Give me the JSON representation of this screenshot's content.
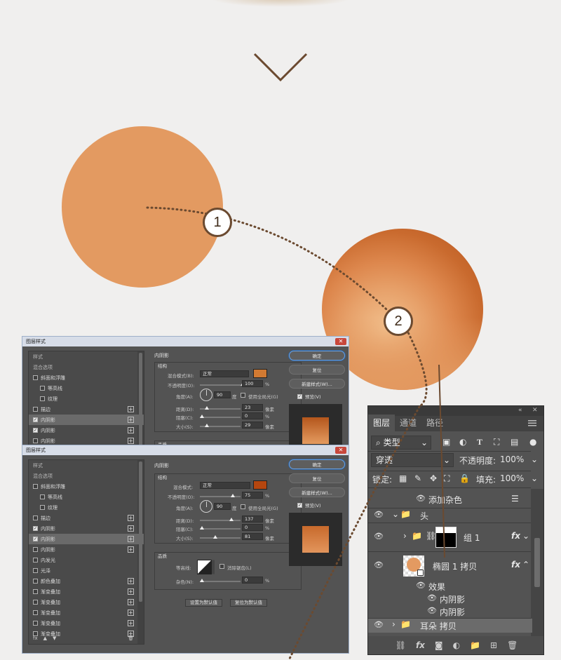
{
  "colors": {
    "background": "#f0efee",
    "accent_orange": "#e39a61",
    "line_brown": "#6b4a30"
  },
  "steps": [
    "1",
    "2"
  ],
  "dialog_top": {
    "title": "图层样式",
    "styles": [
      {
        "label": "样式",
        "checkbox": false,
        "checked": false,
        "plus": false
      },
      {
        "label": "混合选项",
        "checkbox": false,
        "checked": false,
        "plus": false
      },
      {
        "label": "斜面和浮雕",
        "checkbox": true,
        "checked": false,
        "plus": false
      },
      {
        "label": "等高线",
        "checkbox": true,
        "checked": false,
        "plus": false,
        "indent": true
      },
      {
        "label": "纹理",
        "checkbox": true,
        "checked": false,
        "plus": false,
        "indent": true
      },
      {
        "label": "描边",
        "checkbox": true,
        "checked": false,
        "plus": true
      },
      {
        "label": "内阴影",
        "checkbox": true,
        "checked": true,
        "plus": true,
        "selected": true
      },
      {
        "label": "内阴影",
        "checkbox": true,
        "checked": true,
        "plus": true
      },
      {
        "label": "内阴影",
        "checkbox": true,
        "checked": false,
        "plus": true
      }
    ],
    "section_title": "内阴影",
    "group_title": "结构",
    "blend_label": "混合模式(B):",
    "blend_value": "正常",
    "swatch_color": "#d27a32",
    "opacity_label": "不透明度(O):",
    "opacity_value": "100",
    "opacity_fraction": 1.0,
    "angle_label": "角度(A):",
    "angle_value": "90",
    "angle_unit": "度",
    "global_light": "使用全局光(G)",
    "distance_label": "距离(D):",
    "distance_value": "23",
    "distance_fraction": 0.12,
    "choke_label": "阻塞(C):",
    "choke_value": "0",
    "choke_fraction": 0.0,
    "size_label": "大小(S):",
    "size_value": "29",
    "size_fraction": 0.12,
    "unit_px": "像素",
    "unit_pct": "%",
    "quality_title": "品质",
    "buttons": [
      "确定",
      "复位",
      "新建样式(W)..."
    ],
    "preview_label": "预览(V)",
    "preview_color": "#c8743a"
  },
  "dialog_bottom": {
    "title": "图层样式",
    "styles": [
      {
        "label": "样式",
        "checkbox": false,
        "checked": false,
        "plus": false
      },
      {
        "label": "混合选项",
        "checkbox": false,
        "checked": false,
        "plus": false
      },
      {
        "label": "斜面和浮雕",
        "checkbox": true,
        "checked": false,
        "plus": false
      },
      {
        "label": "等高线",
        "checkbox": true,
        "checked": false,
        "plus": false,
        "indent": true
      },
      {
        "label": "纹理",
        "checkbox": true,
        "checked": false,
        "plus": false,
        "indent": true
      },
      {
        "label": "描边",
        "checkbox": true,
        "checked": false,
        "plus": true
      },
      {
        "label": "内阴影",
        "checkbox": true,
        "checked": true,
        "plus": true
      },
      {
        "label": "内阴影",
        "checkbox": true,
        "checked": true,
        "plus": true,
        "selected": true
      },
      {
        "label": "内阴影",
        "checkbox": true,
        "checked": false,
        "plus": true
      },
      {
        "label": "内发光",
        "checkbox": true,
        "checked": false,
        "plus": false
      },
      {
        "label": "光泽",
        "checkbox": true,
        "checked": false,
        "plus": false
      },
      {
        "label": "颜色叠加",
        "checkbox": true,
        "checked": false,
        "plus": true
      },
      {
        "label": "渐变叠加",
        "checkbox": true,
        "checked": false,
        "plus": true
      },
      {
        "label": "渐变叠加",
        "checkbox": true,
        "checked": false,
        "plus": true
      },
      {
        "label": "渐变叠加",
        "checkbox": true,
        "checked": false,
        "plus": true
      },
      {
        "label": "渐变叠加",
        "checkbox": true,
        "checked": false,
        "plus": true
      },
      {
        "label": "渐变叠加",
        "checkbox": true,
        "checked": false,
        "plus": true
      }
    ],
    "section_title": "内阴影",
    "group_title": "结构",
    "blend_label": "混合模式:",
    "blend_value": "正常",
    "swatch_color": "#b5460f",
    "opacity_label": "不透明度(O):",
    "opacity_value": "75",
    "opacity_fraction": 0.75,
    "angle_label": "角度(A):",
    "angle_value": "90",
    "angle_unit": "度",
    "global_light": "使用全局光(G)",
    "distance_label": "距离(D):",
    "distance_value": "137",
    "distance_fraction": 0.72,
    "choke_label": "阻塞(C):",
    "choke_value": "0",
    "choke_fraction": 0.0,
    "size_label": "大小(S):",
    "size_value": "81",
    "size_fraction": 0.33,
    "unit_px": "像素",
    "unit_pct": "%",
    "quality_title": "品质",
    "contour_label": "等高线:",
    "antialias_label": "消除锯齿(L)",
    "noise_label": "杂色(N):",
    "noise_value": "0",
    "noise_fraction": 0.0,
    "set_default": "设置为默认值",
    "reset_default": "复位为默认值",
    "buttons": [
      "确定",
      "复位",
      "新建样式(W)..."
    ],
    "preview_label": "预览(V)",
    "preview_color": "#d27a32"
  },
  "layers_panel": {
    "tabs": [
      "图层",
      "通道",
      "路径"
    ],
    "filter_label": "类型",
    "blend_mode": "穿透",
    "opacity_label": "不透明度:",
    "opacity_value": "100%",
    "lock_label": "锁定:",
    "fill_label": "填充:",
    "fill_value": "100%",
    "layers": {
      "add_noise": "添加杂色",
      "head": "头",
      "group1": "组 1",
      "ellipse_copy": "椭圆 1 拷贝",
      "effects": "效果",
      "inner_shadow_1": "内阴影",
      "inner_shadow_2": "内阴影",
      "ear_copy": "耳朵 拷贝"
    },
    "fx": "fx"
  }
}
